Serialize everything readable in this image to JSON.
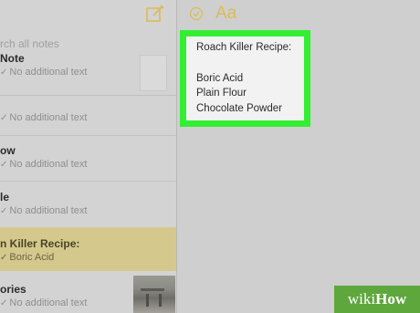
{
  "search": {
    "placeholder": "rch all notes"
  },
  "notes": [
    {
      "title": "Note",
      "preview": "No additional text"
    },
    {
      "title": "",
      "preview": "No additional text"
    },
    {
      "title": "ow",
      "preview": "No additional text"
    },
    {
      "title": "le",
      "preview": "No additional text"
    },
    {
      "title": "n Killer Recipe:",
      "preview": "Boric Acid",
      "selected": true
    },
    {
      "title": "ories",
      "preview": "No additional text"
    }
  ],
  "editor": {
    "font_button": "Aa",
    "lines": [
      "Roach Killer Recipe:",
      "",
      "Boric Acid",
      "Plain Flour",
      "Chocolate Powder"
    ]
  },
  "watermark": {
    "wiki": "wiki",
    "how": "How"
  },
  "colors": {
    "accent": "#d9bd55",
    "highlight": "#33ee33",
    "selected": "#d4c88d"
  }
}
